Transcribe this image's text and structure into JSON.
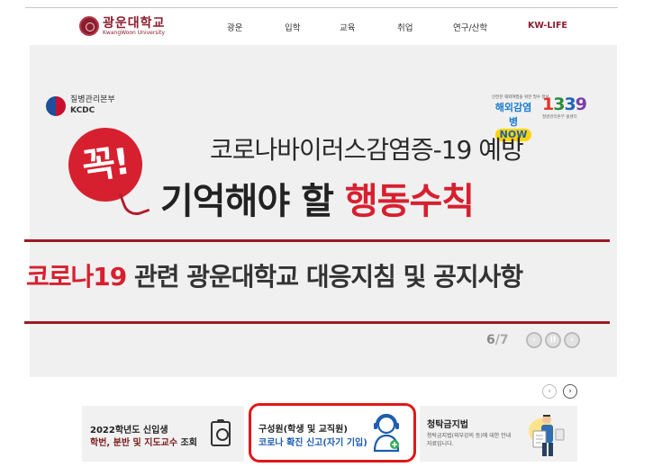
{
  "header": {
    "logo_ko": "광운대학교",
    "logo_en": "KwangWoon University",
    "menu": [
      "광운",
      "입학",
      "교육",
      "취업",
      "연구/산학",
      "KW-LIFE"
    ]
  },
  "banner": {
    "org_ko": "질병관리본부",
    "org_en": "KCDC",
    "travel_top": "안전한 해외여행을 위한 필수 정보",
    "travel_mid": "해외감염병",
    "travel_now": "NOW",
    "hotline": [
      "1",
      "3",
      "3",
      "9"
    ],
    "hotline_sub": "질병관리본부 콜센터",
    "stamp": "꼭!",
    "headline1": "코로나바이러스감염증-19 예방",
    "headline2_black": "기억해야 할",
    "headline2_red": "행동수칙",
    "headline3_red": "코로나19",
    "headline3_black": "관련 광운대학교 대응지침 및 공지사항",
    "slide_current": "6",
    "slide_sep": "/",
    "slide_total": "7",
    "prev_glyph": "‹",
    "pause_glyph": "II",
    "next_glyph": "›"
  },
  "quick": {
    "prev_glyph": "‹",
    "next_glyph": "›",
    "card1_title": "2022학년도 신입생",
    "card1_sub": "학번, 분반 및 지도교수",
    "card1_sub_label": "조회",
    "card2_title": "구성원(학생 및 교직원)",
    "card2_sub": "코로나 확진 신고(자기 기입)",
    "card3_title": "청탁금지법",
    "card3_text": "청탁금지법(외부강의 등)에 대한 안내 자료입니다."
  },
  "colors": {
    "brand": "#8c1d2e",
    "accent_red": "#d7202f",
    "highlight_border": "#e01818",
    "link_blue": "#1e5db0"
  }
}
